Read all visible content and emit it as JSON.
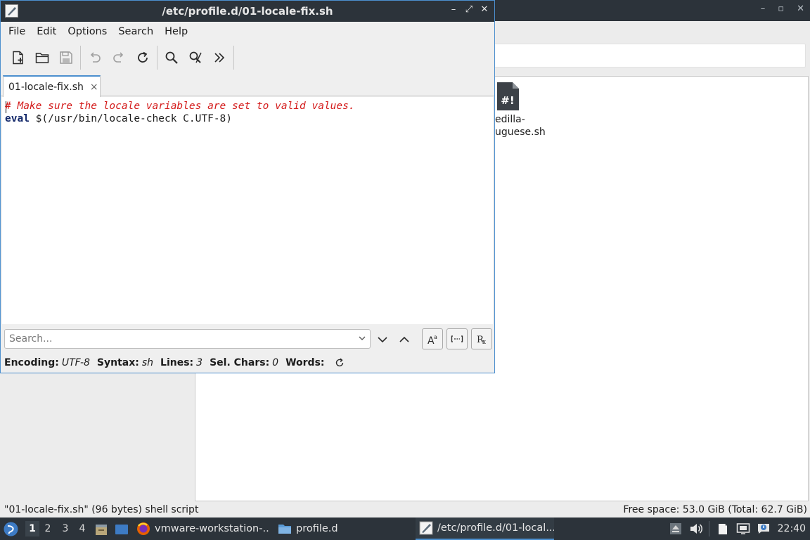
{
  "file_manager": {
    "controls": [
      "–",
      "▫",
      "✕"
    ],
    "file_icon_glyph": "#!",
    "file_label_line1": "edilla-",
    "file_label_line2": "uguese.sh",
    "status_left": "\"01-locale-fix.sh\" (96 bytes) shell script",
    "status_right": "Free space: 53.0 GiB (Total: 62.7 GiB)"
  },
  "editor": {
    "title": "/etc/profile.d/01-locale-fix.sh",
    "menu": [
      "File",
      "Edit",
      "Options",
      "Search",
      "Help"
    ],
    "toolbar": {
      "icons": [
        "new-document-icon",
        "open-folder-icon",
        "save-icon",
        "undo-icon",
        "redo-icon",
        "reload-icon",
        "find-icon",
        "replace-icon",
        "more-icon"
      ]
    },
    "tab": {
      "label": "01-locale-fix.sh",
      "close": "×"
    },
    "code": {
      "line1": "# Make sure the locale variables are set to valid values.",
      "line2_keyword": "eval",
      "line2_rest": " $(/usr/bin/locale-check C.UTF-8)"
    },
    "search": {
      "placeholder": "Search...",
      "value": ""
    },
    "status": {
      "encoding_label": "Encoding:",
      "encoding_value": "UTF-8",
      "syntax_label": "Syntax:",
      "syntax_value": "sh",
      "lines_label": "Lines:",
      "lines_value": "3",
      "selchars_label": "Sel. Chars:",
      "selchars_value": "0",
      "words_label": "Words:"
    }
  },
  "taskbar": {
    "workspaces": [
      "1",
      "2",
      "3",
      "4"
    ],
    "tasks": {
      "vmware": "vmware-workstation-...",
      "profile": "profile.d",
      "editor": "/etc/profile.d/01-local..."
    },
    "clock": "22:40"
  },
  "colors": {
    "titlebar": "#2c333a",
    "accent": "#4c8fce",
    "comment": "#d41b1b",
    "keyword": "#152a6b"
  }
}
